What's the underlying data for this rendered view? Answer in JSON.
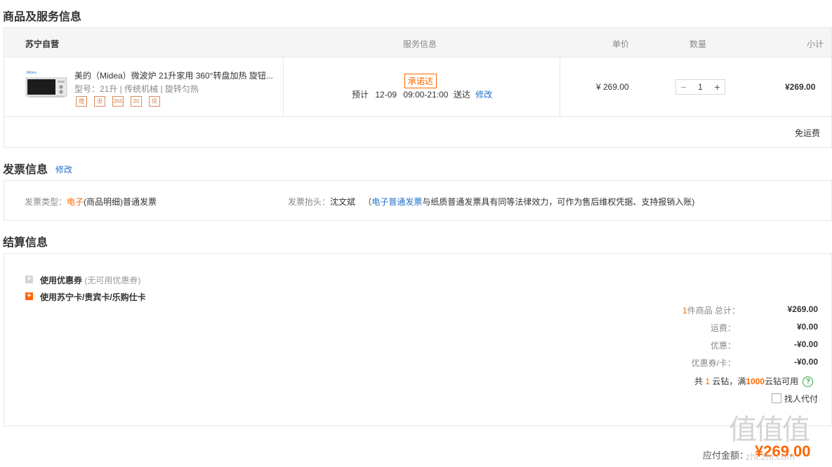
{
  "goods_section": {
    "title": "商品及服务信息",
    "header": {
      "store": "苏宁自营",
      "service": "服务信息",
      "price": "单价",
      "quantity": "数量",
      "subtotal": "小计"
    },
    "item": {
      "brand_logo_text": "Midea",
      "name": "美的（Midea）微波炉 21升家用 360°转盘加热 旋钮...",
      "spec": "型号：21升 | 传统机械 | 旋转匀热",
      "service_tags": [
        "赠",
        "退",
        "365",
        "30",
        "保"
      ],
      "promise_badge": "承诺达",
      "delivery_prefix": "预计",
      "delivery_date": "12-09",
      "delivery_time": "09:00-21:00",
      "delivery_suffix": "送达",
      "modify": "修改",
      "unit_price": "¥ 269.00",
      "minus": "−",
      "quantity": "1",
      "plus": "+",
      "subtotal": "¥269.00"
    },
    "shipping": "免运费"
  },
  "invoice_section": {
    "title": "发票信息",
    "modify": "修改",
    "type_label": "发票类型：",
    "type_highlight": "电子",
    "type_rest": "(商品明细)普通发票",
    "header_label": "发票抬头：",
    "header_value": "沈文斌",
    "note_open": "（",
    "note_link": "电子普通发票",
    "note_rest": "与纸质普通发票具有同等法律效力，可作为售后维权凭据、支持报销入账)"
  },
  "settlement_section": {
    "title": "结算信息",
    "coupon_label": "使用优惠券",
    "coupon_note": "(无可用优惠券)",
    "card_label": "使用苏宁卡/贵宾卡/乐购仕卡",
    "summary": {
      "items_count": "1",
      "items_label": "件商品 总计：",
      "items_total": "¥269.00",
      "freight_label": "运费：",
      "freight_value": "¥0.00",
      "discount_label": "优惠：",
      "discount_value": "-¥0.00",
      "card_label": "优惠券/卡：",
      "card_value": "-¥0.00",
      "yunzuan_prefix": "共",
      "yunzuan_count": "1",
      "yunzuan_mid": "云钻，满",
      "yunzuan_threshold": "1000",
      "yunzuan_suffix": "云钻可用",
      "proxy_pay": "找人代付"
    },
    "payable_label": "应付金额：",
    "payable_value": "¥269.00"
  },
  "watermark": {
    "glyphs": "值值值",
    "site": "zhi.zhi.com"
  },
  "colors": {
    "accent": "#ff6600",
    "link": "#2272c8",
    "border": "#e8e8e8",
    "header_bg": "#f5f5f5",
    "help_green": "#2aa33f"
  }
}
